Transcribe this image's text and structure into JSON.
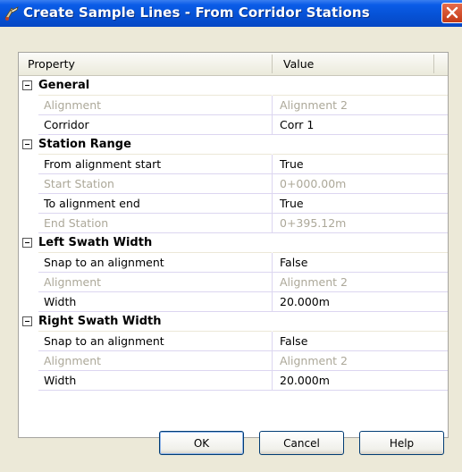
{
  "window": {
    "title": "Create Sample Lines - From Corridor Stations"
  },
  "grid": {
    "columns": [
      "Property",
      "Value"
    ],
    "categories": [
      {
        "label": "General",
        "rows": [
          {
            "name": "Alignment",
            "value": "Alignment 2",
            "enabled": false
          },
          {
            "name": "Corridor",
            "value": "Corr 1",
            "enabled": true
          }
        ]
      },
      {
        "label": "Station Range",
        "rows": [
          {
            "name": "From alignment start",
            "value": "True",
            "enabled": true
          },
          {
            "name": "Start Station",
            "value": "0+000.00m",
            "enabled": false
          },
          {
            "name": "To alignment end",
            "value": "True",
            "enabled": true
          },
          {
            "name": "End Station",
            "value": "0+395.12m",
            "enabled": false
          }
        ]
      },
      {
        "label": "Left Swath Width",
        "rows": [
          {
            "name": "Snap to an alignment",
            "value": "False",
            "enabled": true
          },
          {
            "name": "Alignment",
            "value": "Alignment 2",
            "enabled": false
          },
          {
            "name": "Width",
            "value": "20.000m",
            "enabled": true
          }
        ]
      },
      {
        "label": "Right Swath Width",
        "rows": [
          {
            "name": "Snap to an alignment",
            "value": "False",
            "enabled": true
          },
          {
            "name": "Alignment",
            "value": "Alignment 2",
            "enabled": false
          },
          {
            "name": "Width",
            "value": "20.000m",
            "enabled": true
          }
        ]
      }
    ]
  },
  "buttons": {
    "ok": "OK",
    "cancel": "Cancel",
    "help": "Help"
  },
  "colors": {
    "titlebar": "#0a5ce8",
    "dialog_bg": "#ece9d8",
    "disabled_text": "#aca899",
    "grid_line": "#dcd6f0"
  }
}
